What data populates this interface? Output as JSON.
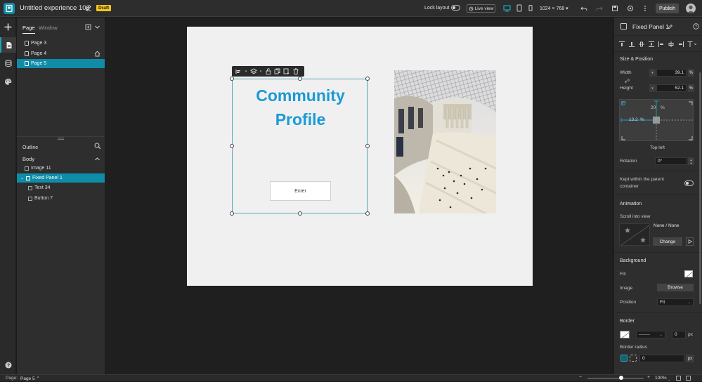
{
  "header": {
    "title": "Untitled experience 106",
    "badge": "Draft",
    "lock_layout_label": "Lock layout",
    "live_view_label": "Live view",
    "resolution": "1024 × 768",
    "publish_label": "Publish"
  },
  "pages_panel": {
    "tab_page": "Page",
    "tab_window": "Window",
    "pages": [
      {
        "label": "Page 3"
      },
      {
        "label": "Page 4"
      },
      {
        "label": "Page 5"
      }
    ],
    "selected_page": "Page 5"
  },
  "outline_panel": {
    "title": "Outline",
    "body_label": "Body",
    "items": [
      {
        "label": "Image 11"
      },
      {
        "label": "Fixed Panel 1"
      },
      {
        "label": "Text 34"
      },
      {
        "label": "Button 7"
      }
    ]
  },
  "canvas": {
    "headline": "Community Profile",
    "button_label": "Enter"
  },
  "right_panel": {
    "title": "Fixed Panel 1",
    "size_position_title": "Size & Position",
    "width_label": "Width",
    "width_value": "39.1",
    "width_unit": "%",
    "height_label": "Height",
    "height_value": "52.1",
    "height_unit": "%",
    "offset_top": "20",
    "offset_top_unit": "%",
    "offset_left": "13.2",
    "offset_left_unit": "%",
    "anchor_label": "Top left",
    "rotation_label": "Rotation",
    "rotation_value": "0°",
    "kept_label_1": "Kept within the parent",
    "kept_label_2": "container",
    "animation_title": "Animation",
    "scroll_into_view_label": "Scroll into view",
    "animation_value": "None / None",
    "change_label": "Change",
    "background_title": "Background",
    "fill_label": "Fill",
    "image_label": "Image",
    "browse_label": "Browse",
    "position_label": "Position",
    "position_value": "Fit",
    "border_title": "Border",
    "border_width": "0",
    "border_unit": "px",
    "border_radius_label": "Border radius",
    "border_radius_value": "0",
    "border_radius_unit": "px"
  },
  "status_bar": {
    "page_label": "Page:",
    "page_value": "Page 5",
    "zoom": "100%"
  },
  "colors": {
    "accent": "#0e8ca8",
    "headline": "#1a9ad6",
    "draft_badge": "#f5c518"
  }
}
